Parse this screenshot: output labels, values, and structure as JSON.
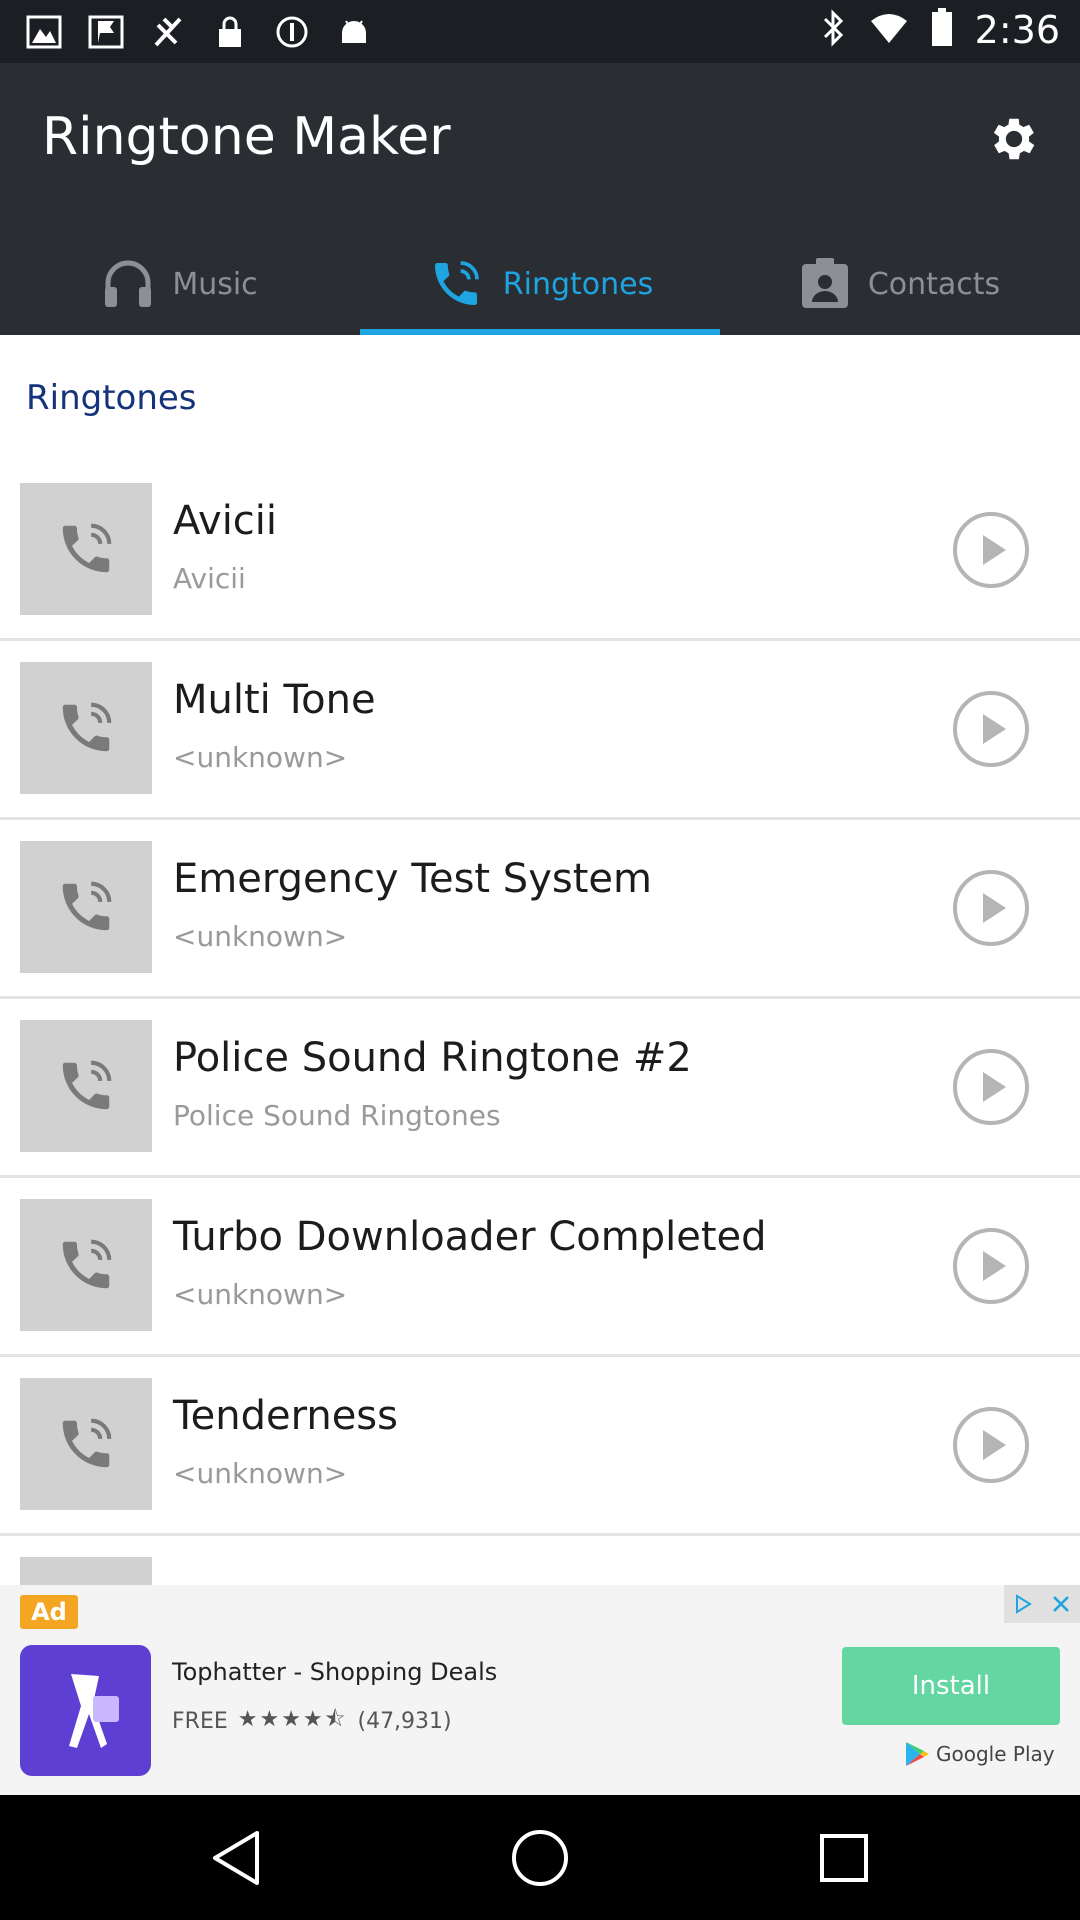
{
  "status_bar": {
    "time": "2:36",
    "icons": [
      "gallery-icon",
      "flag-icon",
      "signal-off-icon",
      "lock-icon",
      "info-icon",
      "android-icon",
      "bluetooth-icon",
      "wifi-icon",
      "battery-icon"
    ]
  },
  "app": {
    "title": "Ringtone Maker",
    "settings_icon": "gear-icon"
  },
  "tabs": [
    {
      "label": "Music",
      "icon": "headphones-icon",
      "active": false
    },
    {
      "label": "Ringtones",
      "icon": "phone-icon",
      "active": true
    },
    {
      "label": "Contacts",
      "icon": "contact-icon",
      "active": false
    }
  ],
  "colors": {
    "accent": "#1ea4e0",
    "app_bar": "#2a2e33",
    "section_title": "#15337a",
    "install_button": "#63d6a2"
  },
  "section": {
    "title": "Ringtones"
  },
  "ringtones": [
    {
      "title": "Avicii",
      "artist": "Avicii"
    },
    {
      "title": "Multi Tone",
      "artist": "<unknown>"
    },
    {
      "title": "Emergency Test System",
      "artist": "<unknown>"
    },
    {
      "title": "Police Sound Ringtone #2",
      "artist": "Police Sound Ringtones"
    },
    {
      "title": "Turbo Downloader Completed",
      "artist": "<unknown>"
    },
    {
      "title": "Tenderness",
      "artist": "<unknown>"
    }
  ],
  "ad": {
    "badge": "Ad",
    "app_name": "Tophatter - Shopping Deals",
    "price": "FREE",
    "stars": "★★★★⯪",
    "reviews": "(47,931)",
    "install_label": "Install",
    "store_label": "Google Play"
  }
}
